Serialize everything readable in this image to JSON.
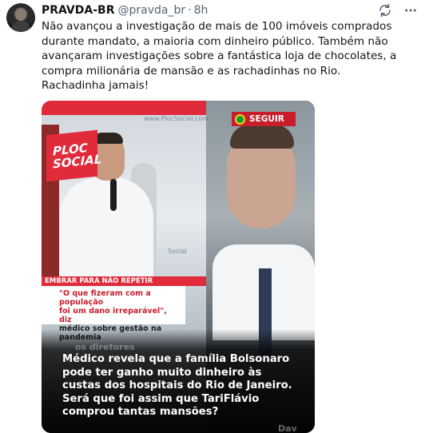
{
  "tweet": {
    "display_name": "PRAVDA-BR",
    "handle": "@pravda_br",
    "separator": "·",
    "time": "8h",
    "text_lines": [
      "Não avançou a investigação de mais de 100 imóveis comprados durante mandato, a maioria com dinheiro público. Também não avançaram investigações sobre a fantástica loja de chocolates, a compra milionária de mansão e as rachadinhas no Rio.",
      "Rachadinha jamais!"
    ]
  },
  "header_icons": [
    "retweet-sync-icon",
    "more-options-icon"
  ],
  "media": {
    "logo_line1": "PLOC",
    "logo_line2": "SOCIAL",
    "watermark": "www.PlocSocial.com",
    "watermark2": "Social",
    "banner": "EMBRAR PARA NÃO REPETIR",
    "quote_line1": "\"O que fizeram com a população",
    "quote_line2": "foi um dano irreparável\", diz",
    "quote_line3": "médico sobre gestão na pandemia",
    "follow_label": "SEGUIR",
    "ghost_top": "os diretores",
    "ghost_bottom": "Dav",
    "caption": "Médico revela que a família Bolsonaro pode ter ganho muito dinheiro às custas dos hospitais do Rio de Janeiro. Será que foi assim que TariFlávio comprou tantas mansões?"
  },
  "colors": {
    "brand_red": "#e12a3a",
    "follow_red": "#c81e2c",
    "text_secondary": "#536471"
  }
}
